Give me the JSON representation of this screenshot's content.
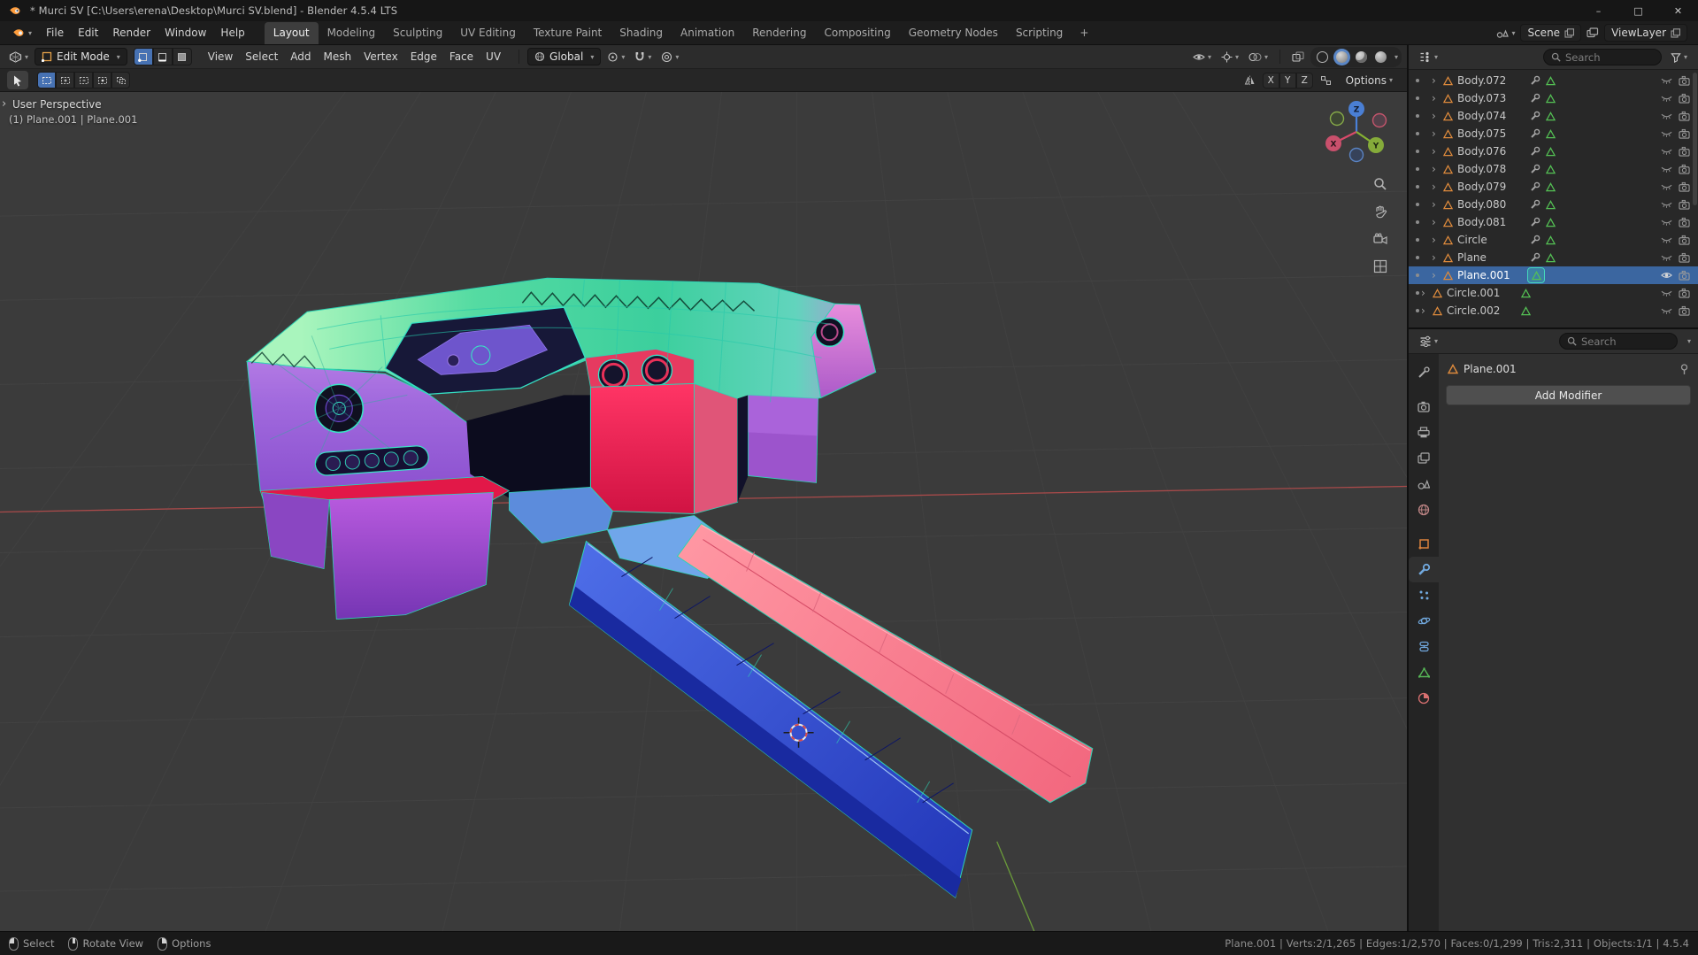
{
  "window": {
    "title": "* Murci SV [C:\\Users\\erena\\Desktop\\Murci SV.blend] - Blender 4.5.4 LTS"
  },
  "topbar": {
    "menus": [
      {
        "label": "File"
      },
      {
        "label": "Edit"
      },
      {
        "label": "Render"
      },
      {
        "label": "Window"
      },
      {
        "label": "Help"
      }
    ],
    "workspaces": [
      {
        "label": "Layout",
        "active": true
      },
      {
        "label": "Modeling"
      },
      {
        "label": "Sculpting"
      },
      {
        "label": "UV Editing"
      },
      {
        "label": "Texture Paint"
      },
      {
        "label": "Shading"
      },
      {
        "label": "Animation"
      },
      {
        "label": "Rendering"
      },
      {
        "label": "Compositing"
      },
      {
        "label": "Geometry Nodes"
      },
      {
        "label": "Scripting"
      }
    ],
    "add_workspace": "+",
    "scene": {
      "label": "Scene"
    },
    "view_layer": {
      "label": "ViewLayer"
    }
  },
  "viewport_header": {
    "mode": "Edit Mode",
    "menus": [
      {
        "label": "View"
      },
      {
        "label": "Select"
      },
      {
        "label": "Add"
      },
      {
        "label": "Mesh"
      },
      {
        "label": "Vertex"
      },
      {
        "label": "Edge"
      },
      {
        "label": "Face"
      },
      {
        "label": "UV"
      }
    ],
    "orientation": "Global"
  },
  "tool_settings": {
    "mirror_axes": [
      {
        "label": "X"
      },
      {
        "label": "Y"
      },
      {
        "label": "Z"
      }
    ],
    "options_label": "Options"
  },
  "viewport": {
    "view_label": "User Perspective",
    "context_label": "(1) Plane.001 | Plane.001",
    "gizmo": {
      "x": "X",
      "y": "Y",
      "z": "Z"
    }
  },
  "outliner": {
    "search_placeholder": "Search",
    "items": [
      {
        "name": "Body.072",
        "wrench": true,
        "eye_closed": true
      },
      {
        "name": "Body.073",
        "wrench": true,
        "eye_closed": true
      },
      {
        "name": "Body.074",
        "wrench": true,
        "eye_closed": true
      },
      {
        "name": "Body.075",
        "wrench": true,
        "eye_closed": true
      },
      {
        "name": "Body.076",
        "wrench": true,
        "eye_closed": true
      },
      {
        "name": "Body.078",
        "wrench": true,
        "eye_closed": true
      },
      {
        "name": "Body.079",
        "wrench": true,
        "eye_closed": true
      },
      {
        "name": "Body.080",
        "wrench": true,
        "eye_closed": true
      },
      {
        "name": "Body.081",
        "wrench": true,
        "eye_closed": true
      },
      {
        "name": "Circle",
        "wrench": true,
        "eye_closed": true
      },
      {
        "name": "Plane",
        "wrench": true,
        "eye_closed": true
      },
      {
        "name": "Plane.001",
        "selected": true,
        "eye_open": true
      },
      {
        "name": "Circle.001",
        "root": true,
        "eye_closed": true
      },
      {
        "name": "Circle.002",
        "root": true,
        "eye_closed": true
      }
    ]
  },
  "properties": {
    "search_placeholder": "Search",
    "context_object": "Plane.001",
    "add_modifier_label": "Add Modifier"
  },
  "statusbar": {
    "hints": [
      {
        "label": "Select",
        "lmb": true
      },
      {
        "label": "Rotate View",
        "mmb": true
      },
      {
        "label": "Options",
        "rmb": true
      }
    ],
    "stats": "Plane.001 | Verts:2/1,265 | Edges:1/2,570 | Faces:0/1,299 | Tris:2,311 | Objects:1/1 | 4.5.4"
  },
  "colors": {
    "accent": "#4772b3",
    "selected_row": "#3b66a0",
    "wireframe": "#3ae2c6",
    "mesh_green": "#4ed89c",
    "mesh_purple": "#a069dd",
    "mesh_red": "#e63a60",
    "mesh_pink_rail": "#f2677e",
    "mesh_blue_rail": "#3a50d0",
    "axis_x": "#b05050",
    "axis_y": "#6a9a3a",
    "axis_z": "#4a80d8"
  }
}
